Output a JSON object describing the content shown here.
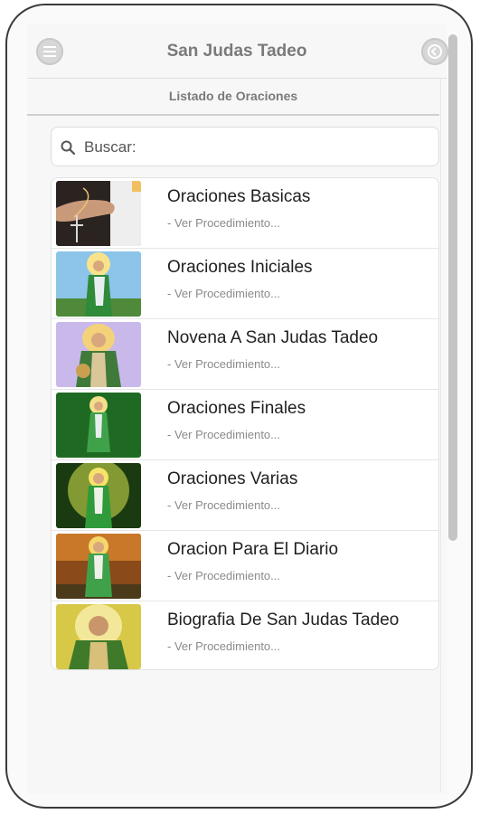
{
  "header": {
    "title": "San Judas Tadeo",
    "menu_icon": "menu-icon",
    "back_icon": "back-icon"
  },
  "subheader": {
    "title": "Listado de Oraciones"
  },
  "search": {
    "placeholder": "Buscar:",
    "icon": "search-icon"
  },
  "items": [
    {
      "title": "Oraciones Basicas",
      "subtitle": "- Ver Procedimiento..."
    },
    {
      "title": "Oraciones Iniciales",
      "subtitle": "- Ver Procedimiento..."
    },
    {
      "title": "Novena A San Judas Tadeo",
      "subtitle": "- Ver Procedimiento..."
    },
    {
      "title": "Oraciones Finales",
      "subtitle": "- Ver Procedimiento..."
    },
    {
      "title": "Oraciones Varias",
      "subtitle": "- Ver Procedimiento..."
    },
    {
      "title": "Oracion Para El Diario",
      "subtitle": "- Ver Procedimiento..."
    },
    {
      "title": "Biografia De San Judas Tadeo",
      "subtitle": "- Ver Procedimiento..."
    }
  ],
  "colors": {
    "accent_green": "#2f8a3a",
    "title_gray": "#7a7a7a"
  }
}
